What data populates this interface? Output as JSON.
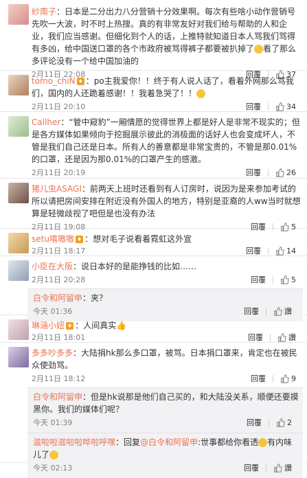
{
  "comments": [
    {
      "name": "紗南子",
      "text": "：日本是二分出力八分营销十分效果啊。每次有些啥小动作营销号先吹一大波，时不时上热搜。真的有非常友好对我们给与帮助的人和企业，我们应当感谢。但细化到个人的话，上推特就知道日本人骂我们骂得有多凶，给中国送口罩的各个市政府被骂得裤子都要被扒掉了",
      "text_tail": "看了那么多评论没有一个给中国加油的",
      "time": "2月11日 22:08",
      "reply_label": "回覆",
      "likes": "37"
    },
    {
      "name": "tomo_chiN",
      "text": "：po主我爱你！！终于有人说人话了，看着外网那么骂我们，国内的人还跪着感谢！！我着急哭了！！",
      "time": "2月11日 20:10",
      "reply_label": "回覆",
      "likes": "34"
    },
    {
      "name": "Callher",
      "text": "：“管中窥豹”一厢情愿的觉得世界上都是好人是非常不现实的；但是各方媒体如果倾向于挖掘展示彼此的消极面的话好人也会变成坏人，不管是我们自己还是日本。所有人的善意都是非常宝贵的，不管是那0.01%的口罩，还是因为那0.01%的口罩产生的感激。",
      "time": "2月11日 20:19",
      "reply_label": "回覆",
      "likes": "26"
    },
    {
      "name": "猪儿虫ASAGI",
      "text": "：前两天上班时还看到有人订房时，说因为是来参加考试的所以请把房间安排在附近没有外国人的地方，特别是亚裔的人ww当时就想算是轻微歧视了吧但是也没有办法",
      "time": "2月11日 19:08",
      "reply_label": "回覆",
      "likes": "5"
    },
    {
      "name": "setu嘻嗷嗷",
      "text": "：想对毛子说看着霓虹这外宣",
      "time": "2月11日 18:17",
      "reply_label": "回覆",
      "likes": "14"
    },
    {
      "name": "小臣在大阪",
      "text": "：说日本好的是能挣钱的比如……",
      "time": "2月11日 20:28",
      "reply_label": "回覆",
      "likes": "5",
      "replies": [
        {
          "name": "白令和阿留申",
          "text": "：夹？",
          "time": "今天 01:36",
          "reply_label": "回覆",
          "like_label": "讚"
        }
      ]
    },
    {
      "name": "琳涵小妞",
      "text": "：人间真实",
      "time": "2月11日 18:01",
      "reply_label": "回覆",
      "like_label": "讚"
    },
    {
      "name": "多多吵多多",
      "text": "：大陆捐hk那么多口罩，被骂。日本捐口罩来，肯定也在被民众使劲骂。",
      "time": "2月11日 18:12",
      "reply_label": "回覆",
      "likes": "9",
      "replies": [
        {
          "name": "白令和阿留申",
          "text": "：但是hk说那是他们自己买的，和大陆没关系，顺便还要摸黑你。我们的媒体们呢？",
          "time": "今天 01:39",
          "reply_label": "回覆",
          "likes": "2"
        },
        {
          "name": "滋啦啦滋啦啦哗啦呼嘿",
          "text_pre": "：回复",
          "mention": "@白令和阿留申",
          "text": ":世事都给你看透",
          "text_tail": "有内味儿了",
          "time": "今天 02:13",
          "reply_label": "回覆",
          "like_label": "讚"
        }
      ]
    }
  ],
  "truncated_next": "·······",
  "colors": {
    "name": "#eb7350",
    "time": "#808080",
    "reply_bg": "#f2f2f5"
  }
}
